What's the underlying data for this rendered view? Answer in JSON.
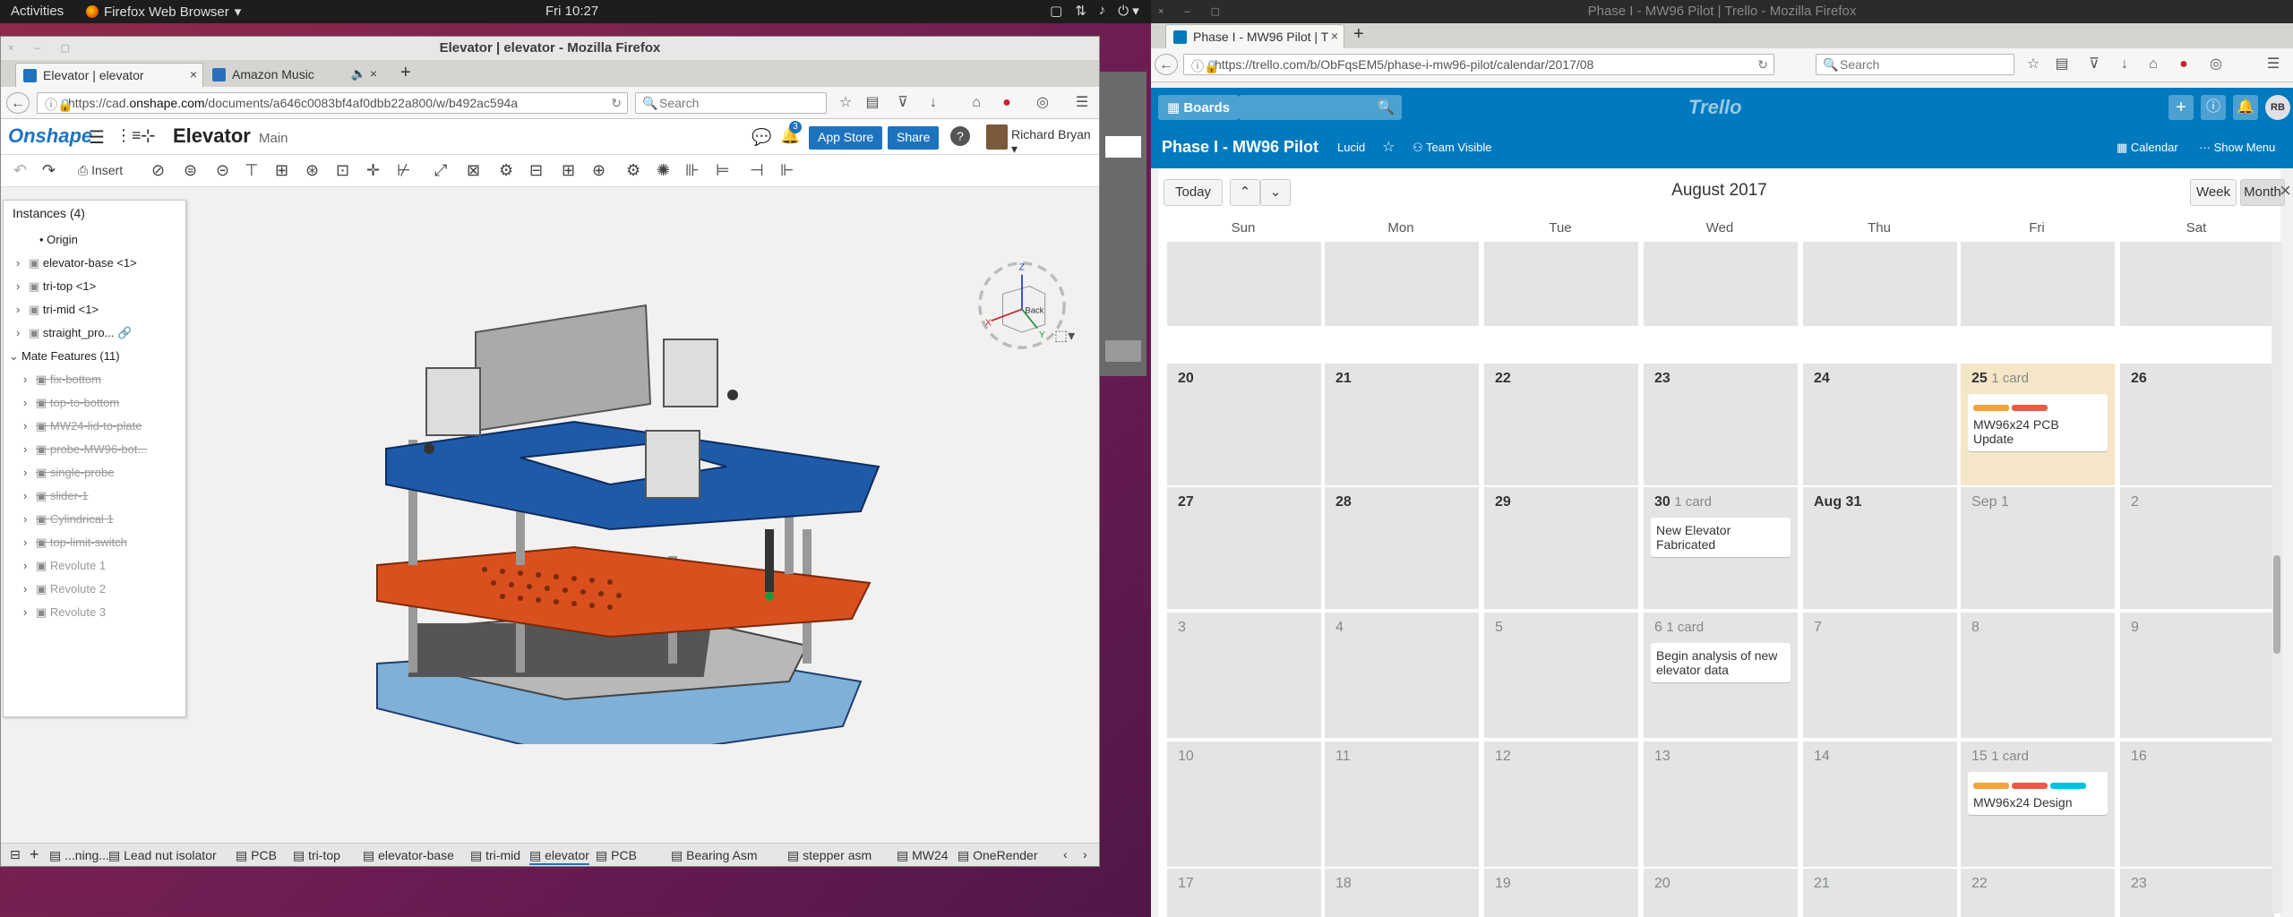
{
  "system": {
    "activities": "Activities",
    "app_name": "Firefox Web Browser",
    "clock": "Fri 10:27"
  },
  "left_window": {
    "title": "Elevator | elevator - Mozilla Firefox",
    "tabs": [
      {
        "label": "Elevator | elevator",
        "active": true
      },
      {
        "label": "Amazon Music",
        "active": false
      }
    ],
    "url_prefix": "https://cad.",
    "url_domain": "onshape.com",
    "url_rest": "/documents/a646c0083bf4af0dbb22a800/w/b492ac594a",
    "search_placeholder": "Search",
    "onshape": {
      "logo": "Onshape",
      "doc_title": "Elevator",
      "workspace": "Main",
      "notif_count": "3",
      "app_store": "App Store",
      "share": "Share",
      "help": "?",
      "user": "Richard Bryan",
      "insert": "Insert"
    },
    "instances_header": "Instances (4)",
    "tree": [
      {
        "label": "Origin",
        "style": "normal"
      },
      {
        "label": "elevator-base <1>",
        "style": "normal"
      },
      {
        "label": "tri-top <1>",
        "style": "normal"
      },
      {
        "label": "tri-mid <1>",
        "style": "normal"
      },
      {
        "label": "straight_pro...",
        "style": "normal"
      },
      {
        "label": "Mate Features (11)",
        "style": "normal"
      },
      {
        "label": "fix-bottom",
        "style": "mute"
      },
      {
        "label": "top-to-bottom",
        "style": "mute"
      },
      {
        "label": "MW24-lid-to-plate",
        "style": "mute"
      },
      {
        "label": "probe-MW96-bot...",
        "style": "mute"
      },
      {
        "label": "single-probe",
        "style": "mute"
      },
      {
        "label": "slider-1",
        "style": "mute"
      },
      {
        "label": "Cylindrical 1",
        "style": "mute"
      },
      {
        "label": "top-limit-switch",
        "style": "mute"
      },
      {
        "label": "Revolute 1",
        "style": "gray"
      },
      {
        "label": "Revolute 2",
        "style": "gray"
      },
      {
        "label": "Revolute 3",
        "style": "gray"
      }
    ],
    "viewcube": {
      "z": "Z",
      "x": "X",
      "y": "Y",
      "face": "Back"
    },
    "bottom_tabs": [
      "...ning...",
      "Lead nut isolator",
      "PCB",
      "tri-top",
      "elevator-base",
      "tri-mid",
      "elevator",
      "PCB",
      "Bearing Asm",
      "stepper asm",
      "MW24",
      "OneRender"
    ],
    "active_bottom_tab": "elevator"
  },
  "right_window": {
    "title": "Phase I - MW96 Pilot | Trello - Mozilla Firefox",
    "tab_label": "Phase I - MW96 Pilot | T",
    "url": "https://trello.com/b/ObFqsEM5/phase-i-mw96-pilot/calendar/2017/08",
    "search_placeholder": "Search",
    "boards_btn": "Boards",
    "trello_logo": "Trello",
    "user_initials": "RB",
    "board_name": "Phase I - MW96 Pilot",
    "team": "Lucid",
    "visibility": "Team Visible",
    "calendar_link": "Calendar",
    "menu_link": "Show Menu",
    "cal": {
      "today": "Today",
      "month_title": "August 2017",
      "week": "Week",
      "month": "Month",
      "days": [
        "Sun",
        "Mon",
        "Tue",
        "Wed",
        "Thu",
        "Fri",
        "Sat"
      ],
      "rows": [
        [
          {
            "n": ""
          },
          {
            "n": ""
          },
          {
            "n": ""
          },
          {
            "n": ""
          },
          {
            "n": ""
          },
          {
            "n": ""
          },
          {
            "n": ""
          }
        ],
        [
          {
            "n": "20"
          },
          {
            "n": "21"
          },
          {
            "n": "22"
          },
          {
            "n": "23"
          },
          {
            "n": "24"
          },
          {
            "n": "25",
            "cnt": "1 card",
            "hl": true,
            "card": "MW96x24 PCB Update",
            "labels": [
              "#f2a33a",
              "#eb5a46"
            ]
          },
          {
            "n": "26"
          }
        ],
        [
          {
            "n": "27"
          },
          {
            "n": "28"
          },
          {
            "n": "29"
          },
          {
            "n": "30",
            "cnt": "1 card",
            "card": "New Elevator Fabricated"
          },
          {
            "n": "Aug 31"
          },
          {
            "n": "Sep 1",
            "dim": true
          },
          {
            "n": "2",
            "dim": true
          }
        ],
        [
          {
            "n": "3",
            "dim": true
          },
          {
            "n": "4",
            "dim": true
          },
          {
            "n": "5",
            "dim": true
          },
          {
            "n": "6",
            "dim": true,
            "cnt": "1 card",
            "card": "Begin analysis of new elevator data"
          },
          {
            "n": "7",
            "dim": true
          },
          {
            "n": "8",
            "dim": true
          },
          {
            "n": "9",
            "dim": true
          }
        ],
        [
          {
            "n": "10",
            "dim": true
          },
          {
            "n": "11",
            "dim": true
          },
          {
            "n": "12",
            "dim": true
          },
          {
            "n": "13",
            "dim": true
          },
          {
            "n": "14",
            "dim": true
          },
          {
            "n": "15",
            "dim": true,
            "cnt": "1 card",
            "card": "MW96x24 Design",
            "labels": [
              "#f2a33a",
              "#eb5a46",
              "#00c2e0"
            ]
          },
          {
            "n": "16",
            "dim": true
          }
        ],
        [
          {
            "n": "17",
            "dim": true
          },
          {
            "n": "18",
            "dim": true
          },
          {
            "n": "19",
            "dim": true
          },
          {
            "n": "20",
            "dim": true
          },
          {
            "n": "21",
            "dim": true
          },
          {
            "n": "22",
            "dim": true
          },
          {
            "n": "23",
            "dim": true
          }
        ]
      ]
    }
  },
  "colors": {
    "onshape_blue": "#1e73be",
    "trello_blue": "#0079bf",
    "cad_blue": "#1f5aa8",
    "cad_orange": "#d9501e"
  }
}
